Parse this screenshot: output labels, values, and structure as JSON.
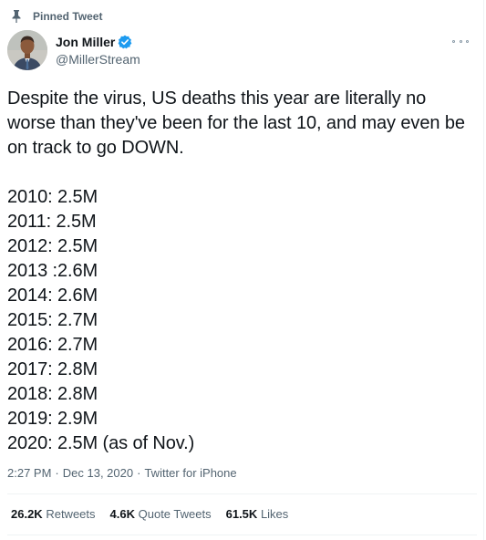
{
  "pinned": {
    "label": "Pinned Tweet",
    "icon": "pin-icon"
  },
  "author": {
    "name": "Jon Miller",
    "handle": "@MillerStream",
    "verified_color": "#1d9bf0"
  },
  "tweet": {
    "intro": "Despite the virus, US deaths this year are literally no worse than they've been for the last 10, and may even be on track to go DOWN.",
    "lines": [
      "2010: 2.5M",
      "2011: 2.5M",
      "2012: 2.5M",
      "2013 :2.6M",
      "2014: 2.6M",
      "2015: 2.7M",
      "2016: 2.7M",
      "2017: 2.8M",
      "2018: 2.8M",
      "2019: 2.9M",
      "2020: 2.5M (as of Nov.)"
    ]
  },
  "meta": {
    "time": "2:27 PM",
    "date": "Dec 13, 2020",
    "source": "Twitter for iPhone",
    "separator": "·"
  },
  "stats": {
    "retweets_count": "26.2K",
    "retweets_label": "Retweets",
    "quotes_count": "4.6K",
    "quotes_label": "Quote Tweets",
    "likes_count": "61.5K",
    "likes_label": "Likes"
  }
}
